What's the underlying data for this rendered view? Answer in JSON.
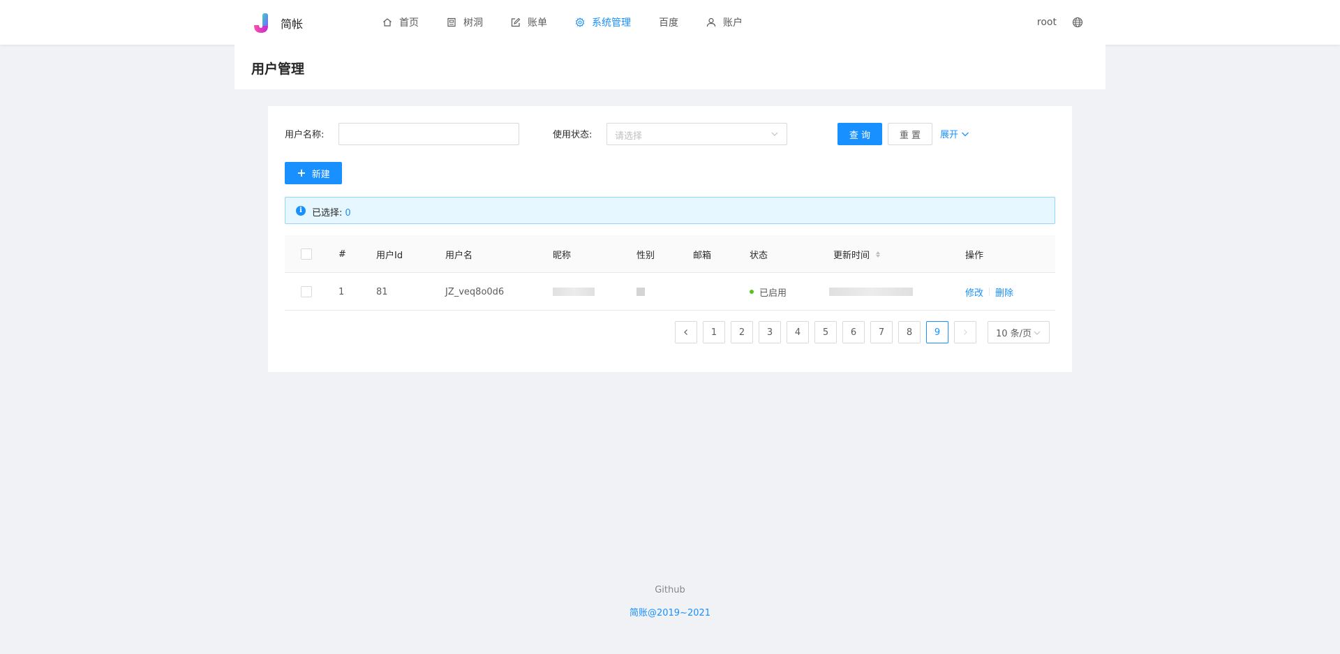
{
  "app": {
    "name": "简帐",
    "brand_color": "#1890ff"
  },
  "nav": {
    "items": [
      {
        "label": "首页",
        "icon": "home-icon"
      },
      {
        "label": "树洞",
        "icon": "tree-hole-icon"
      },
      {
        "label": "账单",
        "icon": "edit-icon"
      },
      {
        "label": "系统管理",
        "icon": "setting-icon",
        "active": true
      },
      {
        "label": "百度",
        "icon": ""
      },
      {
        "label": "账户",
        "icon": "user-icon"
      }
    ]
  },
  "header": {
    "username": "root",
    "language_icon": "globe-icon"
  },
  "page": {
    "title": "用户管理"
  },
  "search": {
    "username_label": "用户名称:",
    "username_value": "",
    "status_label": "使用状态:",
    "status_placeholder": "请选择",
    "query_label": "查 询",
    "reset_label": "重 置",
    "expand_label": "展开"
  },
  "toolbar": {
    "new_label": "新建"
  },
  "alert": {
    "selected_label": "已选择:",
    "selected_count": "0"
  },
  "table": {
    "columns": [
      "#",
      "用户Id",
      "用户名",
      "昵称",
      "性别",
      "邮箱",
      "状态",
      "更新时间",
      "操作"
    ],
    "rows": [
      {
        "index": "1",
        "id": "81",
        "username": "JZ_veq8o0d6",
        "nickname": "",
        "gender": "",
        "email": "",
        "status": "已启用",
        "updated": "",
        "edit": "修改",
        "delete": "删除"
      }
    ]
  },
  "pagination": {
    "pages": [
      "1",
      "2",
      "3",
      "4",
      "5",
      "6",
      "7",
      "8",
      "9"
    ],
    "current": "9",
    "page_size": "10 条/页"
  },
  "footer": {
    "link": "Github",
    "copyright": "简账@2019~2021"
  }
}
